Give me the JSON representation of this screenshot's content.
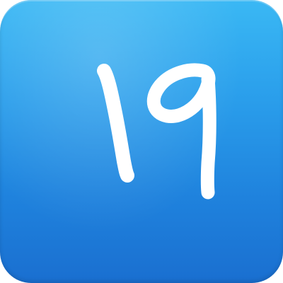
{
  "app_icon": {
    "label": "19",
    "accent_color_top": "#3ab8f4",
    "accent_color_bottom": "#1a6fd0",
    "glyph_color": "#ffffff",
    "icon_name": "number-19-icon"
  }
}
